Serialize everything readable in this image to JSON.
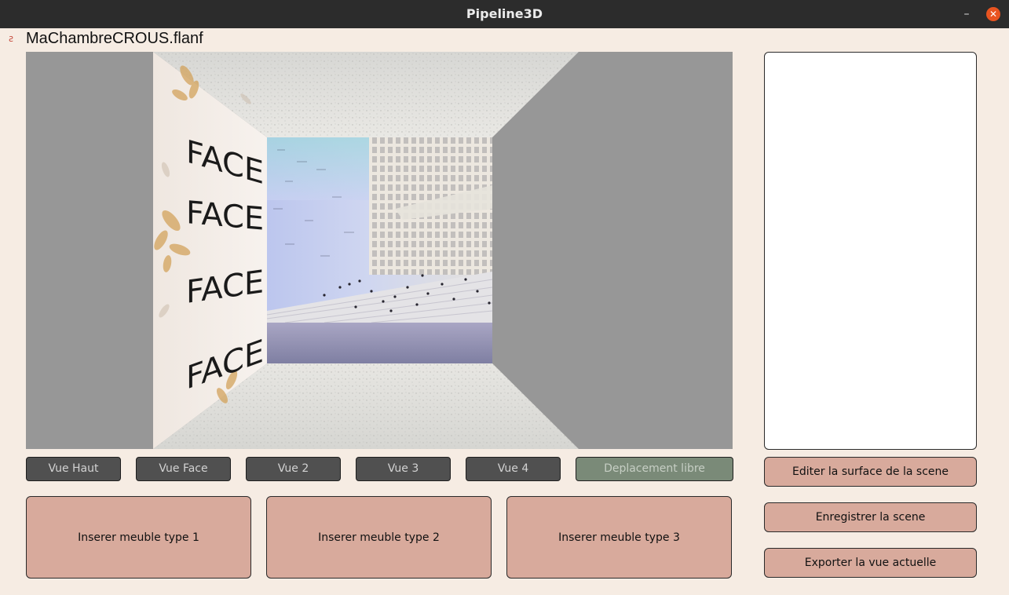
{
  "window": {
    "title": "Pipeline3D",
    "minimize_glyph": "–",
    "close_glyph": "✕",
    "close_color": "#e95420"
  },
  "document": {
    "filename": "MaChambreCROUS.flanf"
  },
  "viewport": {
    "wall_text": [
      "FACE",
      "FACE",
      "FACE",
      "FACE"
    ],
    "background_color": "#979797"
  },
  "view_buttons": [
    {
      "label": "Vue Haut"
    },
    {
      "label": "Vue Face"
    },
    {
      "label": "Vue 2"
    },
    {
      "label": "Vue 3"
    },
    {
      "label": "Vue 4"
    },
    {
      "label": "Deplacement libre"
    }
  ],
  "insert_buttons": [
    {
      "label": "Inserer meuble type 1"
    },
    {
      "label": "Inserer meuble type 2"
    },
    {
      "label": "Inserer meuble type 3"
    }
  ],
  "side_actions": {
    "edit_surface": "Editer la surface de la scene",
    "save_scene": "Enregistrer la scene",
    "export_view": "Exporter la vue actuelle"
  },
  "colors": {
    "window_bg": "#f6ece3",
    "action_button": "#d8aa9c",
    "view_button": "#505050",
    "free_move_button": "#7a8a78"
  }
}
